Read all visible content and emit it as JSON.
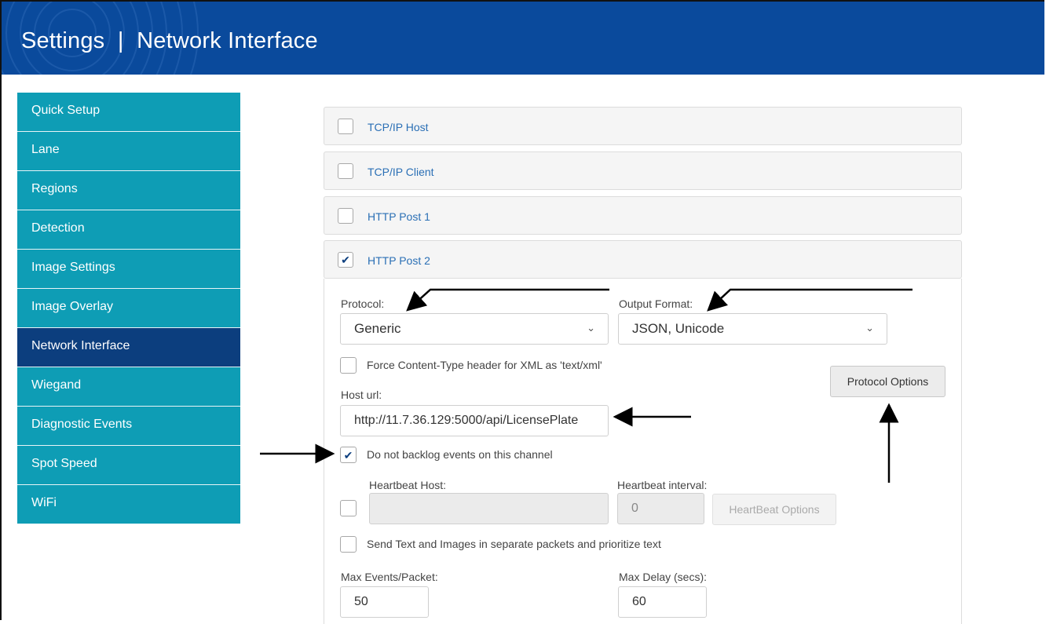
{
  "header": {
    "title": "Settings  |  Network Interface"
  },
  "sidebar": {
    "items": [
      {
        "label": "Quick Setup",
        "active": false
      },
      {
        "label": "Lane",
        "active": false
      },
      {
        "label": "Regions",
        "active": false
      },
      {
        "label": "Detection",
        "active": false
      },
      {
        "label": "Image Settings",
        "active": false
      },
      {
        "label": "Image Overlay",
        "active": false
      },
      {
        "label": "Network Interface",
        "active": true
      },
      {
        "label": "Wiegand",
        "active": false
      },
      {
        "label": "Diagnostic Events",
        "active": false
      },
      {
        "label": "Spot Speed",
        "active": false
      },
      {
        "label": "WiFi",
        "active": false
      }
    ]
  },
  "channels": [
    {
      "label": "TCP/IP Host",
      "checked": false
    },
    {
      "label": "TCP/IP Client",
      "checked": false
    },
    {
      "label": "HTTP Post 1",
      "checked": false
    },
    {
      "label": "HTTP Post 2",
      "checked": true
    }
  ],
  "form": {
    "protocol_label": "Protocol:",
    "protocol_value": "Generic",
    "output_format_label": "Output Format:",
    "output_format_value": "JSON, Unicode",
    "force_content_type_label": "Force Content-Type header for XML as 'text/xml'",
    "force_content_type_checked": false,
    "protocol_options_button": "Protocol Options",
    "host_url_label": "Host url:",
    "host_url_value": "http://11.7.36.129:5000/api/LicensePlate",
    "no_backlog_label": "Do not backlog events on this channel",
    "no_backlog_checked": true,
    "heartbeat_host_label": "Heartbeat Host:",
    "heartbeat_host_value": "",
    "heartbeat_interval_label": "Heartbeat interval:",
    "heartbeat_interval_value": "0",
    "heartbeat_checked": false,
    "heartbeat_options_button": "HeartBeat Options",
    "separate_packets_label": "Send Text and Images in separate packets and prioritize text",
    "separate_packets_checked": false,
    "max_events_label": "Max Events/Packet:",
    "max_events_value": "50",
    "max_delay_label": "Max Delay (secs):",
    "max_delay_value": "60"
  },
  "colors": {
    "header": "#0a4a9c",
    "sidebar_item": "#0e9db5",
    "sidebar_active": "#0c3e7e",
    "link": "#2a6fb5"
  }
}
